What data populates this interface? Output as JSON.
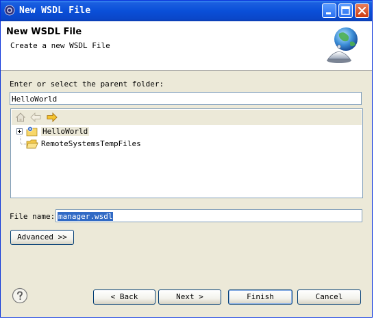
{
  "window": {
    "title": "New WSDL File"
  },
  "header": {
    "title": "New WSDL File",
    "description": "Create a new WSDL File"
  },
  "folder": {
    "label": "Enter or select the parent folder:",
    "value": "HelloWorld"
  },
  "tree": {
    "items": [
      {
        "label": "HelloWorld",
        "expander": "⊞"
      },
      {
        "label": "RemoteSystemsTempFiles"
      }
    ]
  },
  "file": {
    "label": "File name:",
    "value": "manager.wsdl"
  },
  "buttons": {
    "advanced": "Advanced >>",
    "back": "< Back",
    "next": "Next >",
    "finish": "Finish",
    "cancel": "Cancel"
  },
  "colors": {
    "titlebar": "#0a4fd8",
    "selection": "#316ac5",
    "dialog_bg": "#ece9d8"
  }
}
